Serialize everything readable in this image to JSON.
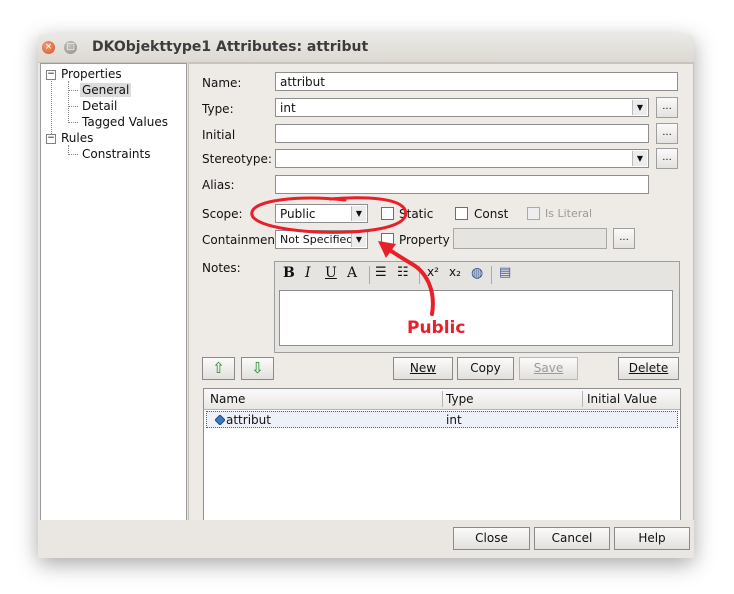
{
  "window": {
    "title": "DKObjekttype1 Attributes: attribut",
    "close_glyph": "×",
    "max_glyph": "□"
  },
  "tree": {
    "properties": "Properties",
    "general": "General",
    "detail": "Detail",
    "tagged_values": "Tagged Values",
    "rules": "Rules",
    "constraints": "Constraints",
    "expander": "−"
  },
  "form": {
    "name_label": "Name:",
    "name_value": "attribut",
    "type_label": "Type:",
    "type_value": "int",
    "initial_label": "Initial",
    "stereotype_label": "Stereotype:",
    "alias_label": "Alias:",
    "scope_label": "Scope:",
    "scope_value": "Public",
    "static_label": "Static",
    "const_label": "Const",
    "is_literal_label": "Is Literal",
    "containment_label": "Containment",
    "containment_value": "Not Specified",
    "property_label": "Property",
    "notes_label": "Notes:",
    "ellipsis": "...",
    "dropdown_glyph": "▼"
  },
  "notes_toolbar": {
    "bold": "B",
    "italic": "I",
    "underline": "U",
    "font_color": "A",
    "bullets": "☰",
    "numbering": "☷",
    "superscript": "x²",
    "subscript": "x₂",
    "insert_object": "◍",
    "page": "▤"
  },
  "buttons": {
    "up": "⇧",
    "down": "⇩",
    "new": "New",
    "copy": "Copy",
    "save": "Save",
    "delete": "Delete",
    "close": "Close",
    "cancel": "Cancel",
    "help": "Help"
  },
  "grid": {
    "columns": [
      "Name",
      "Type",
      "Initial Value"
    ],
    "rows": [
      {
        "name": "attribut",
        "type": "int",
        "initial": ""
      }
    ]
  },
  "annotation": {
    "text": "Public",
    "color": "#e8202a"
  },
  "colors": {
    "window_bg": "#eae7e2",
    "close_button": "#df4b16",
    "annotation": "#e8202a"
  }
}
